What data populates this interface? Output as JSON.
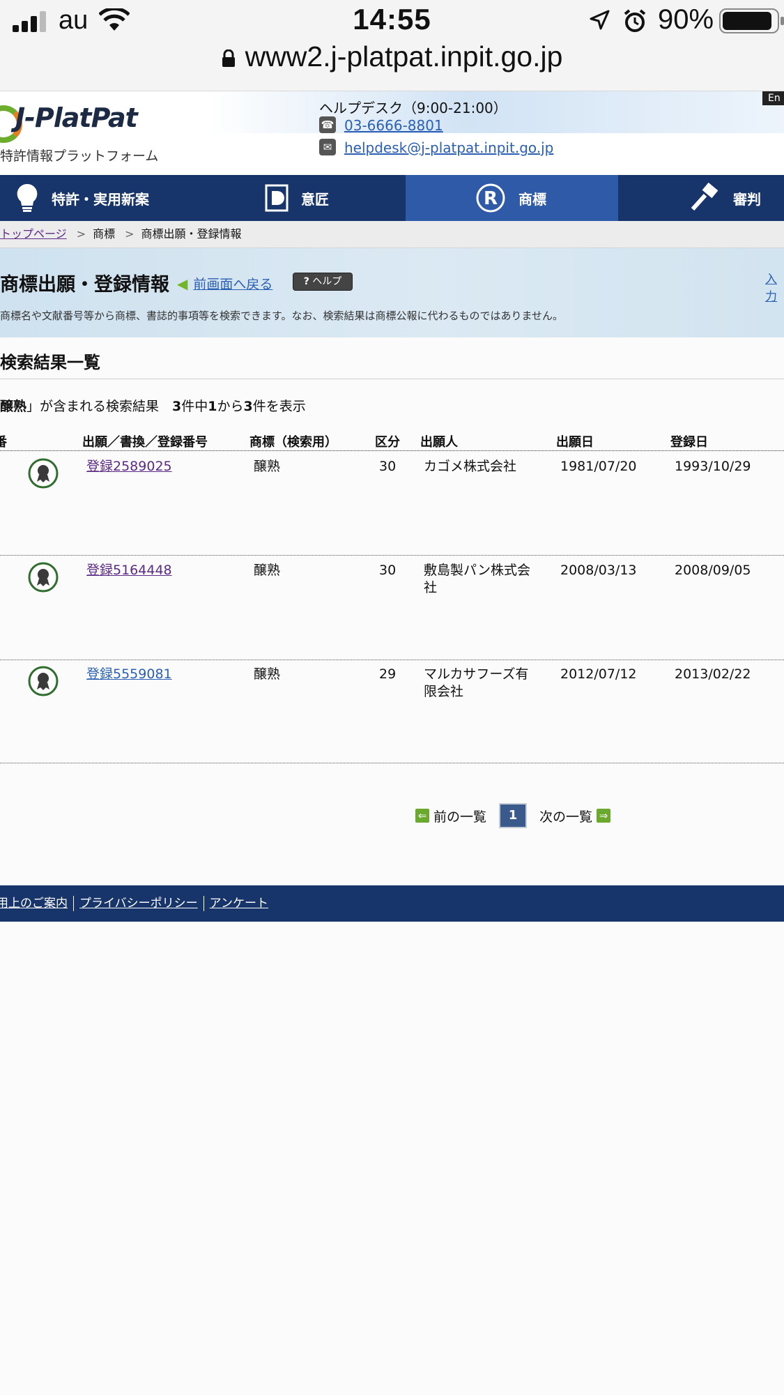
{
  "status_bar": {
    "carrier": "au",
    "time": "14:55",
    "battery": "90%",
    "url": "www2.j-platpat.inpit.go.jp"
  },
  "header": {
    "logo_text": "J-PlatPat",
    "logo_sub": "特許情報プラットフォーム",
    "helpdesk_label": "ヘルプデスク（9:00-21:00）",
    "phone": "03-6666-8801",
    "email": "helpdesk@j-platpat.inpit.go.jp",
    "en_label": "En"
  },
  "nav": {
    "items": [
      {
        "label": "特許・実用新案",
        "icon": "lightbulb-icon"
      },
      {
        "label": "意匠",
        "icon": "design-icon"
      },
      {
        "label": "商標",
        "icon": "trademark-icon",
        "active": true
      },
      {
        "label": "審判",
        "icon": "gavel-icon"
      }
    ]
  },
  "breadcrumb": {
    "items": [
      "トップページ",
      "商標",
      "商標出願・登録情報"
    ]
  },
  "title_band": {
    "title": "商標出願・登録情報",
    "back_link": "前画面へ戻る",
    "help_button": "ヘルプ",
    "input_link": "入力",
    "description": "商標名や文献番号等から商標、書誌的事項等を検索できます。なお、検索結果は商標公報に代わるものではありません。"
  },
  "results": {
    "heading": "検索結果一覧",
    "summary_keyword": "醸熟",
    "summary_text_1": "」が含まれる検索結果　",
    "total": "3",
    "summary_text_2": "件中",
    "from": "1",
    "summary_text_3": "から",
    "to": "3",
    "summary_text_4": "件を表示",
    "columns": [
      "番",
      "出願／書換／登録番号",
      "商標（検索用）",
      "区分",
      "出願人",
      "出願日",
      "登録日"
    ],
    "rows": [
      {
        "number": "登録2589025",
        "mark": "醸熟",
        "class": "30",
        "applicant_1": "カゴメ株式会社",
        "applicant_2": "",
        "filing_date": "1981/07/20",
        "reg_date": "1993/10/29",
        "visited": true
      },
      {
        "number": "登録5164448",
        "mark": "醸熟",
        "class": "30",
        "applicant_1": "敷島製パン株式会",
        "applicant_2": "社",
        "filing_date": "2008/03/13",
        "reg_date": "2008/09/05",
        "visited": true
      },
      {
        "number": "登録5559081",
        "mark": "醸熟",
        "class": "29",
        "applicant_1": "マルカサフーズ有",
        "applicant_2": "限会社",
        "filing_date": "2012/07/12",
        "reg_date": "2013/02/22",
        "visited": false
      }
    ]
  },
  "pagination": {
    "prev": "前の一覧",
    "current": "1",
    "next": "次の一覧"
  },
  "footer": {
    "links": [
      "利用上のご案内",
      "プライバシーポリシー",
      "アンケート"
    ]
  }
}
